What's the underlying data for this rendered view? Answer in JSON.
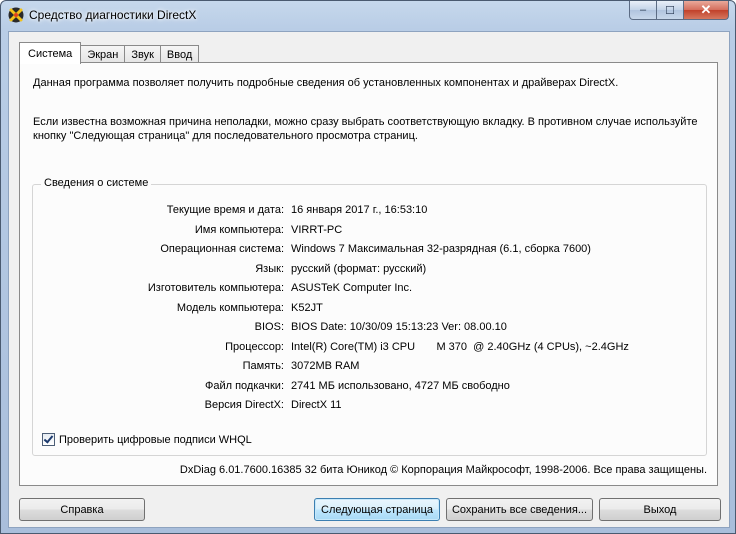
{
  "window": {
    "title": "Средство диагностики DirectX",
    "minimize_glyph": "‒",
    "maximize_glyph": "☐",
    "close_glyph": "✕"
  },
  "tabs": [
    {
      "label": "Система",
      "active": true
    },
    {
      "label": "Экран",
      "active": false
    },
    {
      "label": "Звук",
      "active": false
    },
    {
      "label": "Ввод",
      "active": false
    }
  ],
  "intro": {
    "line1": "Данная программа позволяет получить подробные сведения об установленных компонентах и драйверах DirectX.",
    "line2": "Если известна возможная причина неполадки, можно сразу выбрать соответствующую вкладку. В противном случае используйте кнопку \"Следующая страница\" для последовательного просмотра страниц."
  },
  "system_info": {
    "group_title": "Сведения о системе",
    "rows": [
      {
        "label": "Текущие время и дата:",
        "value": "16 января 2017 г., 16:53:10"
      },
      {
        "label": "Имя компьютера:",
        "value": "VIRRT-PC"
      },
      {
        "label": "Операционная система:",
        "value": "Windows 7 Максимальная 32-разрядная (6.1, сборка 7600)"
      },
      {
        "label": "Язык:",
        "value": "русский (формат: русский)"
      },
      {
        "label": "Изготовитель компьютера:",
        "value": "ASUSTeK Computer Inc."
      },
      {
        "label": "Модель компьютера:",
        "value": "K52JT"
      },
      {
        "label": "BIOS:",
        "value": "BIOS Date: 10/30/09 15:13:23 Ver: 08.00.10"
      },
      {
        "label": "Процессор:",
        "value": "Intel(R) Core(TM) i3 CPU       M 370  @ 2.40GHz (4 CPUs), ~2.4GHz"
      },
      {
        "label": "Память:",
        "value": "3072MB RAM"
      },
      {
        "label": "Файл подкачки:",
        "value": "2741 МБ использовано, 4727 МБ свободно"
      },
      {
        "label": "Версия DirectX:",
        "value": "DirectX 11"
      }
    ],
    "whql_label": "Проверить цифровые подписи WHQL",
    "whql_checked": true
  },
  "copyright": "DxDiag 6.01.7600.16385 32 бита Юникод  © Корпорация Майкрософт, 1998-2006.  Все права защищены.",
  "buttons": {
    "help": "Справка",
    "next": "Следующая страница",
    "save": "Сохранить все сведения...",
    "exit": "Выход"
  },
  "colors": {
    "title_bar": "#b9cde6",
    "client_bg": "#f0f0f0",
    "close_button": "#c1412a",
    "default_button_border": "#3c7fb1"
  }
}
